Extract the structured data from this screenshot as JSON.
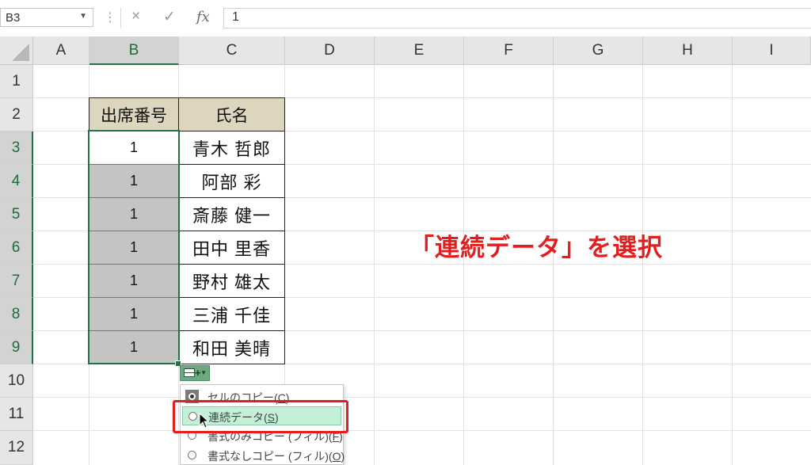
{
  "formula_bar": {
    "name_box": "B3",
    "cancel_icon": "×",
    "confirm_icon": "✓",
    "fx_label": "fx",
    "formula_value": "1"
  },
  "columns": [
    "A",
    "B",
    "C",
    "D",
    "E",
    "F",
    "G",
    "H",
    "I"
  ],
  "rows": [
    "1",
    "2",
    "3",
    "4",
    "5",
    "6",
    "7",
    "8",
    "9",
    "10",
    "11",
    "12"
  ],
  "table": {
    "header": [
      "出席番号",
      "氏名"
    ],
    "rows": [
      {
        "number": "1",
        "name": "青木 哲郎"
      },
      {
        "number": "1",
        "name": "阿部 彩"
      },
      {
        "number": "1",
        "name": "斎藤 健一"
      },
      {
        "number": "1",
        "name": "田中 里香"
      },
      {
        "number": "1",
        "name": "野村 雄太"
      },
      {
        "number": "1",
        "name": "三浦 千佳"
      },
      {
        "number": "1",
        "name": "和田 美晴"
      }
    ]
  },
  "autofill_menu": {
    "items": [
      {
        "label": "セルのコピー(",
        "key": "C",
        "suffix": ")"
      },
      {
        "label": "連続データ(",
        "key": "S",
        "suffix": ")"
      },
      {
        "label": "書式のみコピー (フィル)(",
        "key": "F",
        "suffix": ")"
      },
      {
        "label": "書式なしコピー (フィル)(",
        "key": "O",
        "suffix": ")"
      }
    ]
  },
  "annotation": "「連続データ」を選択",
  "colors": {
    "selection": "#217346",
    "highlight": "#c5f0d8",
    "annotation": "#e21e1e",
    "header_fill": "#ddd5bd"
  },
  "icons": [
    "chevron-down-icon",
    "more-dots-icon",
    "cancel-icon",
    "confirm-icon",
    "fx-icon",
    "autofill-options-icon",
    "mouse-pointer-icon"
  ]
}
